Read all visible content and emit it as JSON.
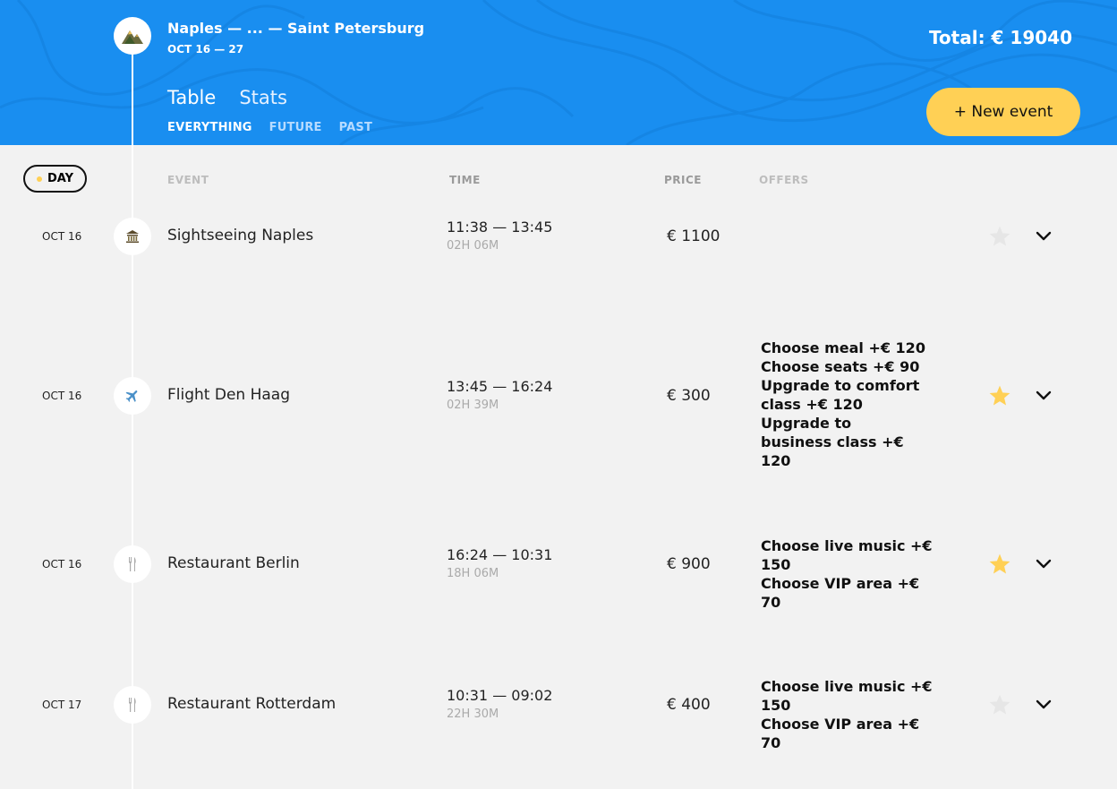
{
  "trip": {
    "title": "Naples — ... — Saint Petersburg",
    "dates": "OCT 16 — 27",
    "total": "Total: € 19040",
    "logo_icon": "mountains-icon"
  },
  "tabs": [
    {
      "label": "Table",
      "active": true
    },
    {
      "label": "Stats",
      "active": false
    }
  ],
  "filters": [
    {
      "label": "EVERYTHING",
      "active": true
    },
    {
      "label": "FUTURE",
      "active": false
    },
    {
      "label": "PAST",
      "active": false
    }
  ],
  "new_event_label": "+ New event",
  "sort": {
    "day_label": "DAY",
    "event_label": "EVENT",
    "time_label": "TIME",
    "price_label": "PRICE",
    "offers_label": "OFFERS"
  },
  "events": [
    {
      "date": "OCT 16",
      "type": "sightseeing-icon",
      "name": "Sightseeing Naples",
      "time": "11:38 — 13:45",
      "duration": "02H 06M",
      "price": "€ 1100",
      "offers": [],
      "favorite": false
    },
    {
      "date": "OCT 16",
      "type": "flight-icon",
      "name": "Flight Den Haag",
      "time": "13:45 — 16:24",
      "duration": "02H 39M",
      "price": "€ 300",
      "offers": [
        "Choose meal +€  120",
        "Choose seats +€  90",
        "Upgrade to comfort class +€  120",
        "Upgrade to business class +€  120"
      ],
      "favorite": true
    },
    {
      "date": "OCT 16",
      "type": "restaurant-icon",
      "name": "Restaurant Berlin",
      "time": "16:24 — 10:31",
      "duration": "18H 06M",
      "price": "€ 900",
      "offers": [
        "Choose live music +€  150",
        "Choose VIP area +€  70"
      ],
      "favorite": true
    },
    {
      "date": "OCT 17",
      "type": "restaurant-icon",
      "name": "Restaurant Rotterdam",
      "time": "10:31 — 09:02",
      "duration": "22H 30M",
      "price": "€ 400",
      "offers": [
        "Choose live music +€  150",
        "Choose VIP area +€  70"
      ],
      "favorite": false
    }
  ],
  "colors": {
    "header_bg": "#198ef0",
    "accent_yellow": "#ffd055",
    "page_bg": "#f2f2f2",
    "star_off": "#e6e6e6"
  }
}
